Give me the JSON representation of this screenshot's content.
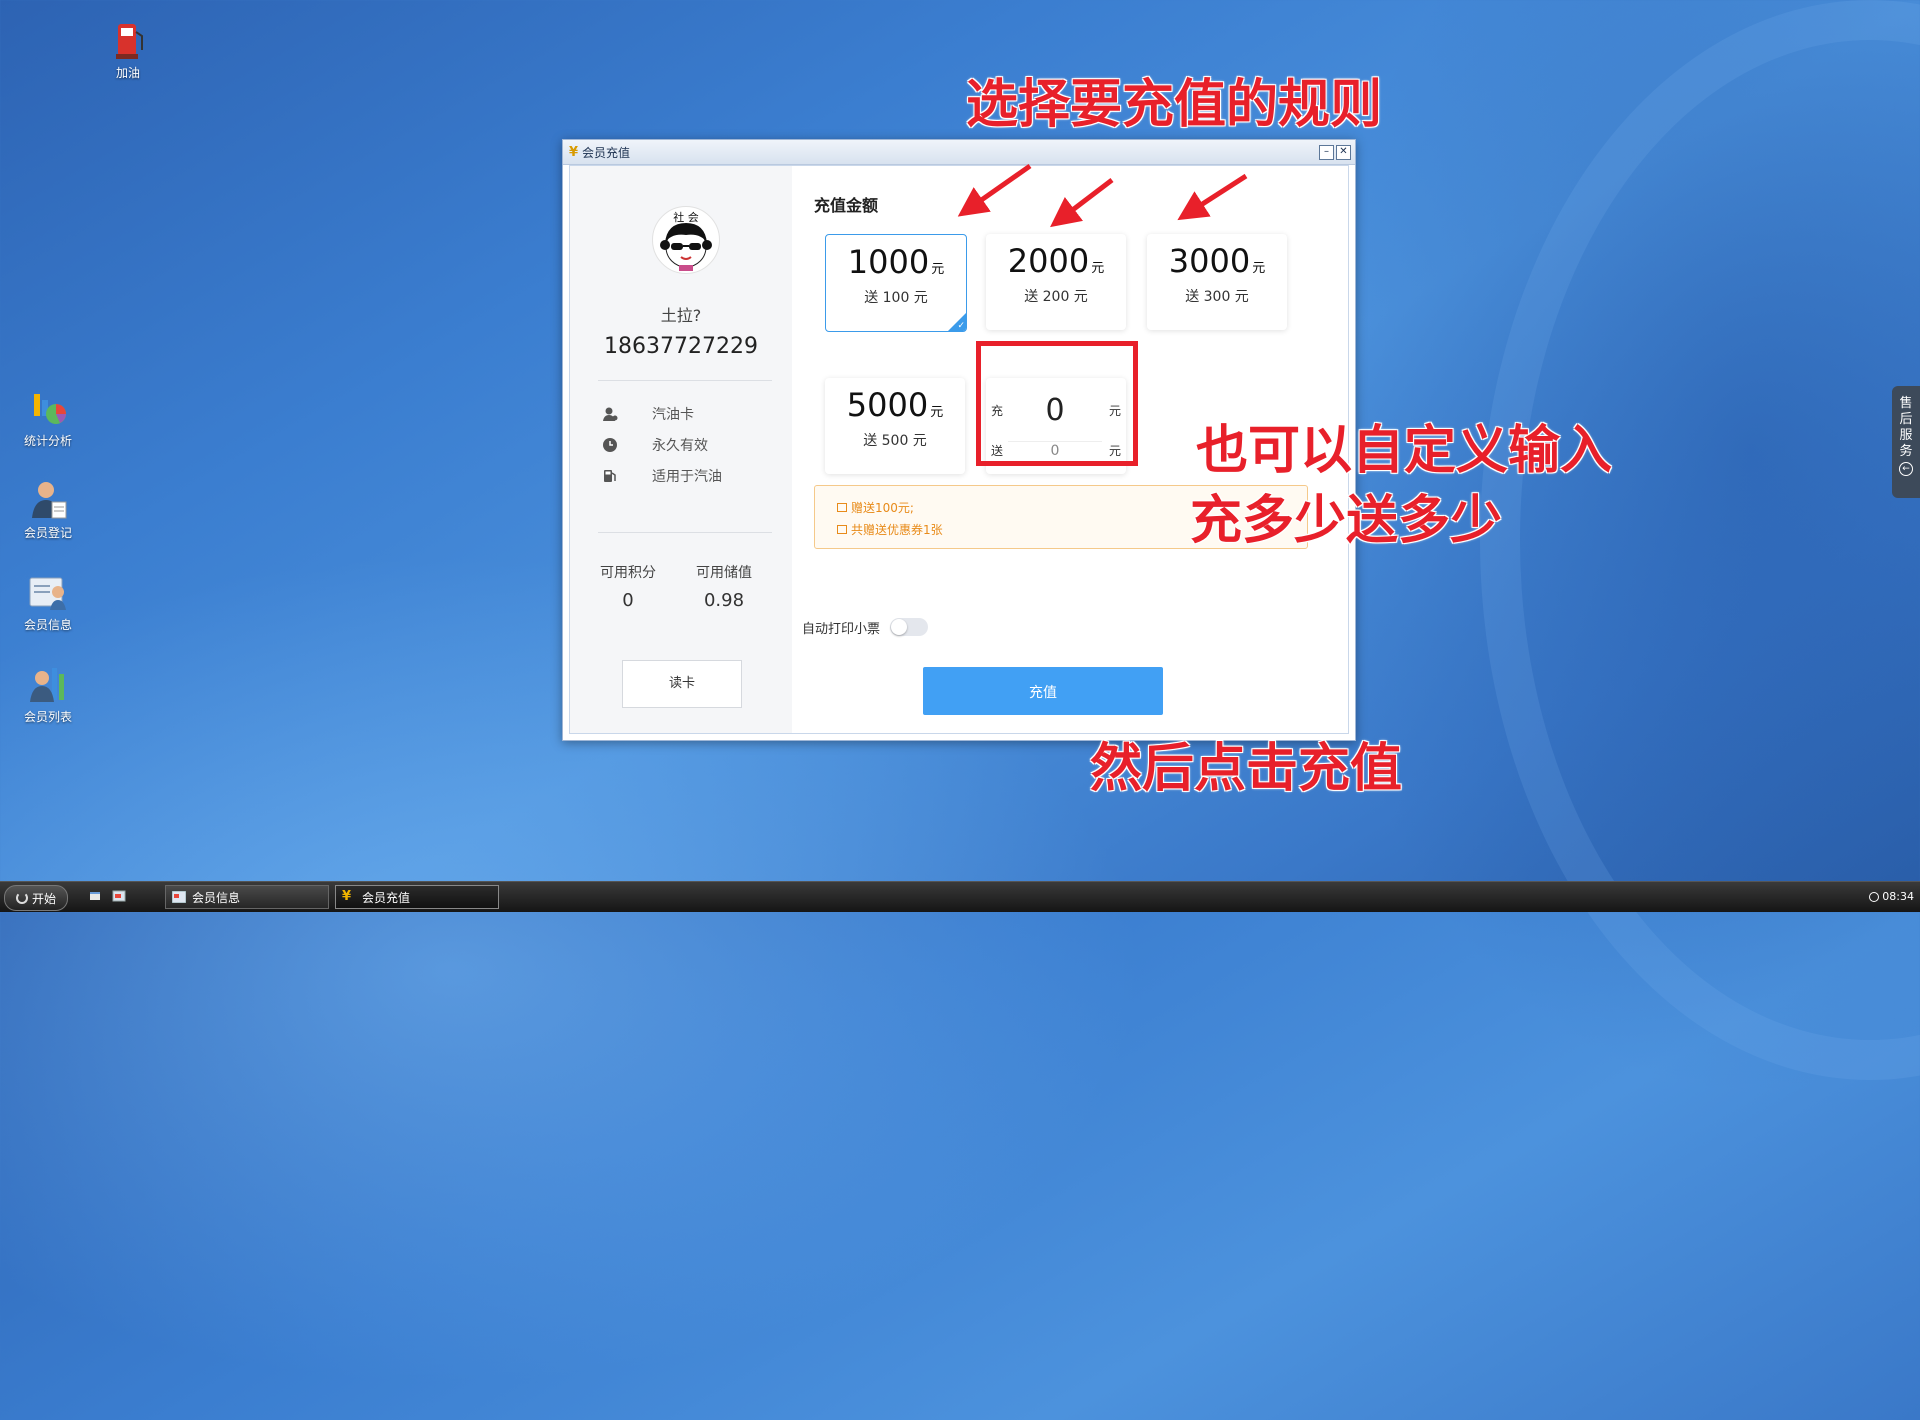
{
  "desktop": {
    "icons": [
      {
        "label": "加油"
      },
      {
        "label": "统计分析"
      },
      {
        "label": "会员登记"
      },
      {
        "label": "会员信息"
      },
      {
        "label": "会员列表"
      }
    ]
  },
  "dialog": {
    "title": "会员充值",
    "member": {
      "avatar_text": "社 会",
      "name": "土拉?",
      "phone": "18637727229",
      "card_type": "汽油卡",
      "validity": "永久有效",
      "usage": "适用于汽油",
      "points_label": "可用积分",
      "points_value": "0",
      "balance_label": "可用储值",
      "balance_value": "0.98",
      "read_card_label": "读卡"
    },
    "section_title": "充值金额",
    "unit": "元",
    "options": [
      {
        "amount": "1000",
        "bonus": "送 100 元",
        "selected": true
      },
      {
        "amount": "2000",
        "bonus": "送 200 元",
        "selected": false
      },
      {
        "amount": "3000",
        "bonus": "送 300 元",
        "selected": false
      },
      {
        "amount": "5000",
        "bonus": "送 500 元",
        "selected": false
      }
    ],
    "custom": {
      "recharge_prefix": "充",
      "recharge_value": "0",
      "bonus_prefix": "送",
      "bonus_value": "0",
      "unit": "元"
    },
    "notice": {
      "line1": "赠送100元;",
      "line2": "共赠送优惠券1张"
    },
    "auto_print_label": "自动打印小票",
    "auto_print_on": false,
    "submit_label": "充值"
  },
  "annotations": {
    "top": "选择要充值的规则",
    "middle_line1": "也可以自定义输入",
    "middle_line2": "充多少送多少",
    "bottom": "然后点击充值",
    "color": "#e8202a"
  },
  "side_tab": {
    "chars": [
      "售",
      "后",
      "服",
      "务"
    ]
  },
  "taskbar": {
    "start_label": "开始",
    "tasks": [
      {
        "label": "会员信息",
        "active": false
      },
      {
        "label": "会员充值",
        "active": true
      }
    ],
    "clock": "08:34"
  }
}
